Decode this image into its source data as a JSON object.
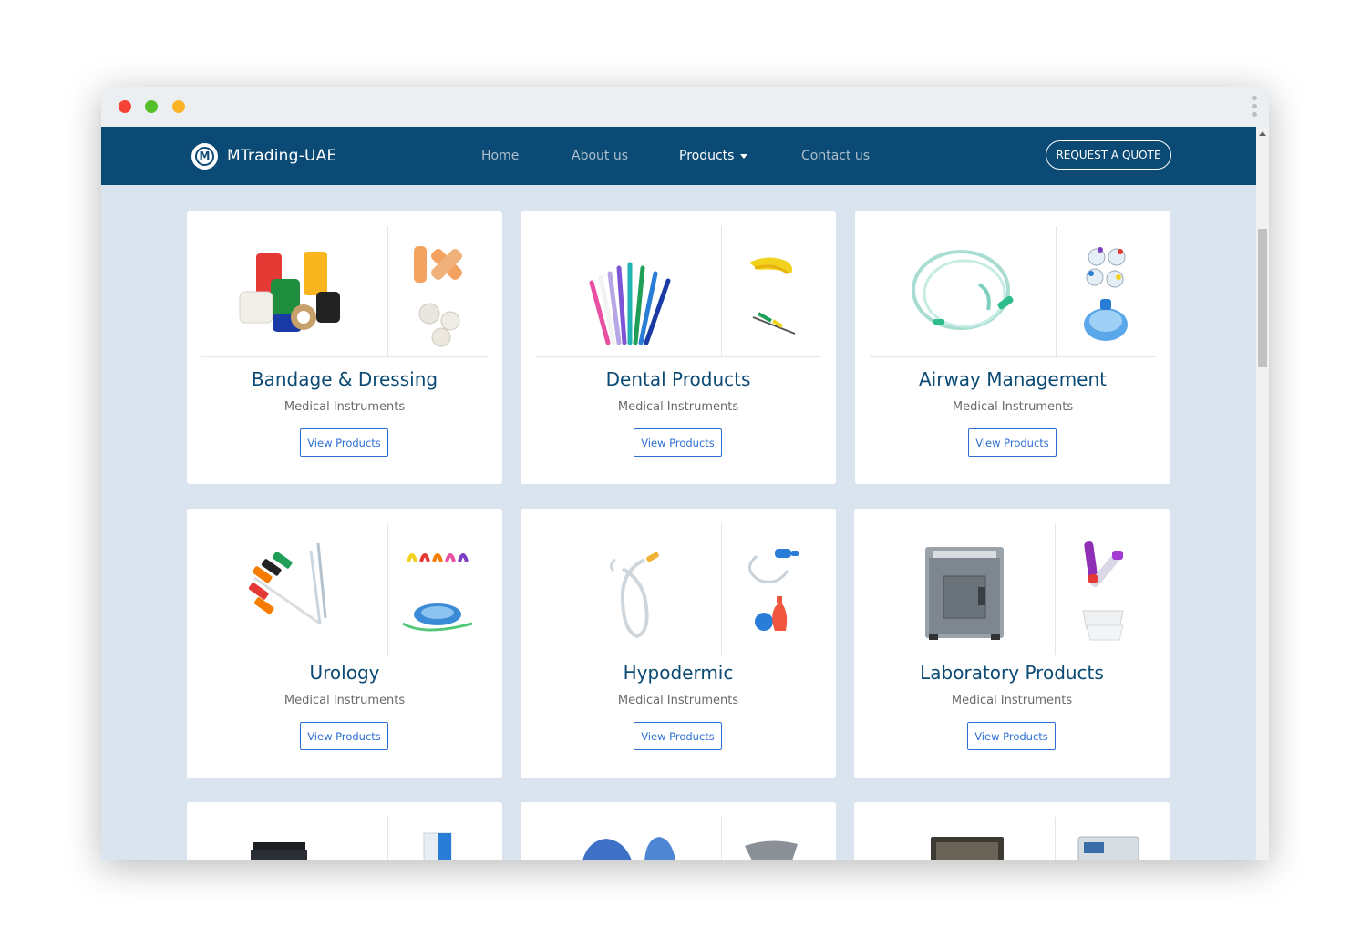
{
  "nav": {
    "brand": "MTrading-UAE",
    "brand_initial": "M",
    "links": [
      {
        "label": "Home"
      },
      {
        "label": "About us"
      },
      {
        "label": "Products"
      },
      {
        "label": "Contact us"
      }
    ],
    "quote_button": "REQUEST A QUOTE"
  },
  "cards": [
    {
      "title": "Bandage & Dressing",
      "subtitle": "Medical Instruments",
      "button": "View Products"
    },
    {
      "title": "Dental Products",
      "subtitle": "Medical Instruments",
      "button": "View Products"
    },
    {
      "title": "Airway Management",
      "subtitle": "Medical Instruments",
      "button": "View Products"
    },
    {
      "title": "Urology",
      "subtitle": "Medical Instruments",
      "button": "View Products"
    },
    {
      "title": "Hypodermic",
      "subtitle": "Medical Instruments",
      "button": "View Products"
    },
    {
      "title": "Laboratory Products",
      "subtitle": "Medical Instruments",
      "button": "View Products"
    }
  ],
  "colors": {
    "navbar": "#0b4a74",
    "page_background": "#d9e4ee",
    "title": "#0b4a74",
    "button_border": "#2d6fd2"
  }
}
